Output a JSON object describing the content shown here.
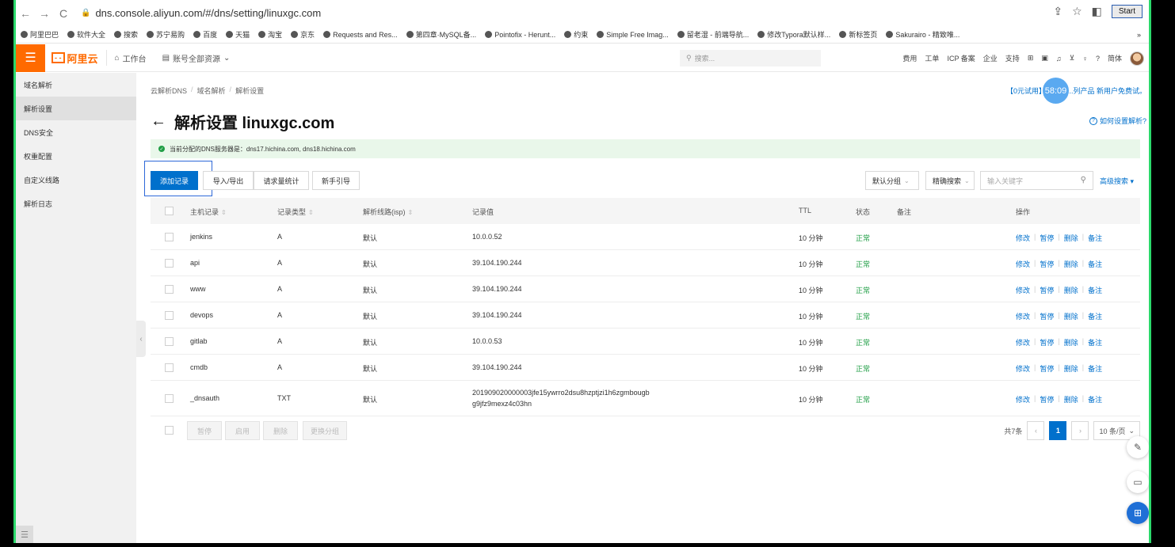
{
  "browser": {
    "url": "dns.console.aliyun.com/#/dns/setting/linuxgc.com",
    "start_label": "Start",
    "bookmarks": [
      "阿里巴巴",
      "软件大全",
      "搜索",
      "苏宁易购",
      "百度",
      "天猫",
      "淘宝",
      "京东",
      "Requests and Res...",
      "第四章·MySQL备...",
      "Pointofix - Herunt...",
      "约束",
      "Simple Free Imag...",
      "留老湿 - 前端导航...",
      "修改Typora默认样...",
      "新标签页",
      "Sakurairo - 精致唯..."
    ],
    "bookmarks_more": "»"
  },
  "topbar": {
    "logo_text": "阿里云",
    "workbench": "工作台",
    "account_resources": "账号全部资源",
    "search_placeholder": "搜索...",
    "links": [
      "费用",
      "工单",
      "ICP 备案",
      "企业",
      "支持"
    ],
    "lang": "简体"
  },
  "sidebar": {
    "items": [
      "域名解析",
      "解析设置",
      "DNS安全",
      "权重配置",
      "自定义线路",
      "解析日志"
    ],
    "active_index": 1
  },
  "breadcrumb": [
    "云解析DNS",
    "域名解析",
    "解析设置"
  ],
  "breadcrumb_sep": "/",
  "promo_text": "【0元试用】阿里云...列产品 新用户免费试。",
  "timer": "58:09",
  "page_title": "解析设置 linuxgc.com",
  "help_link": "如何设置解析?",
  "notice": "当前分配的DNS服务器是：dns17.hichina.com, dns18.hichina.com",
  "toolbar": {
    "add_record": "添加记录",
    "import_export": "导入/导出",
    "request_stats": "请求量统计",
    "guide": "新手引导",
    "group_select": "默认分组",
    "search_mode": "精确搜索",
    "keyword_placeholder": "输入关键字",
    "advanced_search": "高级搜索"
  },
  "table": {
    "headers": [
      "主机记录",
      "记录类型",
      "解析线路(isp)",
      "记录值",
      "TTL",
      "状态",
      "备注",
      "操作"
    ],
    "rows": [
      {
        "host": "jenkins",
        "type": "A",
        "line": "默认",
        "value": "10.0.0.52",
        "value2": "",
        "ttl": "10 分钟",
        "status": "正常"
      },
      {
        "host": "api",
        "type": "A",
        "line": "默认",
        "value": "39.104.190.244",
        "value2": "",
        "ttl": "10 分钟",
        "status": "正常"
      },
      {
        "host": "www",
        "type": "A",
        "line": "默认",
        "value": "39.104.190.244",
        "value2": "",
        "ttl": "10 分钟",
        "status": "正常"
      },
      {
        "host": "devops",
        "type": "A",
        "line": "默认",
        "value": "39.104.190.244",
        "value2": "",
        "ttl": "10 分钟",
        "status": "正常"
      },
      {
        "host": "gitlab",
        "type": "A",
        "line": "默认",
        "value": "10.0.0.53",
        "value2": "",
        "ttl": "10 分钟",
        "status": "正常"
      },
      {
        "host": "cmdb",
        "type": "A",
        "line": "默认",
        "value": "39.104.190.244",
        "value2": "",
        "ttl": "10 分钟",
        "status": "正常"
      },
      {
        "host": "_dnsauth",
        "type": "TXT",
        "line": "默认",
        "value": "201909020000003jfe15ywrro2dsu8hzptjzi1h6zgmbougb",
        "value2": "g9jfz9mexz4c03hn",
        "ttl": "10 分钟",
        "status": "正常"
      }
    ],
    "ops": [
      "修改",
      "暂停",
      "删除",
      "备注"
    ]
  },
  "bulk": {
    "pause": "暂停",
    "enable": "启用",
    "delete": "删除",
    "change_group": "更换分组"
  },
  "pager": {
    "total": "共7条",
    "current": "1",
    "page_size": "10 条/页"
  },
  "colors": {
    "brand": "#ff6a00",
    "primary": "#0070cc",
    "success": "#1f9e45"
  }
}
